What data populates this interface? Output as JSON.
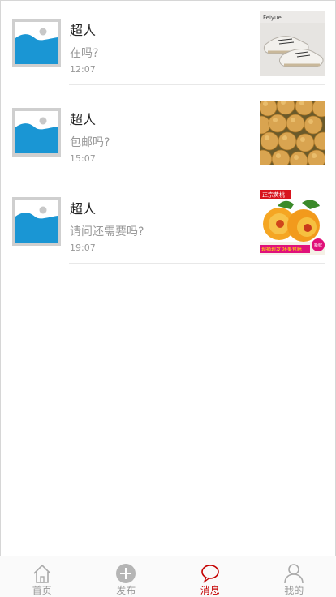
{
  "messages": [
    {
      "name": "超人",
      "preview": "在吗?",
      "time": "12:07",
      "thumb": "shoes-photo",
      "avatar": "image-placeholder-icon"
    },
    {
      "name": "超人",
      "preview": "包邮吗?",
      "time": "15:07",
      "thumb": "pears-photo",
      "avatar": "image-placeholder-icon"
    },
    {
      "name": "超人",
      "preview": "请问还需要吗?",
      "time": "19:07",
      "thumb": "peaches-photo",
      "avatar": "image-placeholder-icon"
    }
  ],
  "tabbar": {
    "items": [
      {
        "label": "首页",
        "icon": "home-icon",
        "active": false
      },
      {
        "label": "发布",
        "icon": "plus-circle-icon",
        "active": false
      },
      {
        "label": "消息",
        "icon": "chat-bubble-icon",
        "active": true
      },
      {
        "label": "我的",
        "icon": "user-icon",
        "active": false
      }
    ]
  },
  "colors": {
    "accent": "#c40000",
    "placeholder_blue": "#1a96d4",
    "tab_inactive": "#999999"
  },
  "thumb_text": {
    "shoe_brand": "Feiyue",
    "peach_top_tag": "正宗黄桃",
    "peach_banner": "现摘现发 坏果包赔",
    "peach_corner": "新鲜"
  }
}
